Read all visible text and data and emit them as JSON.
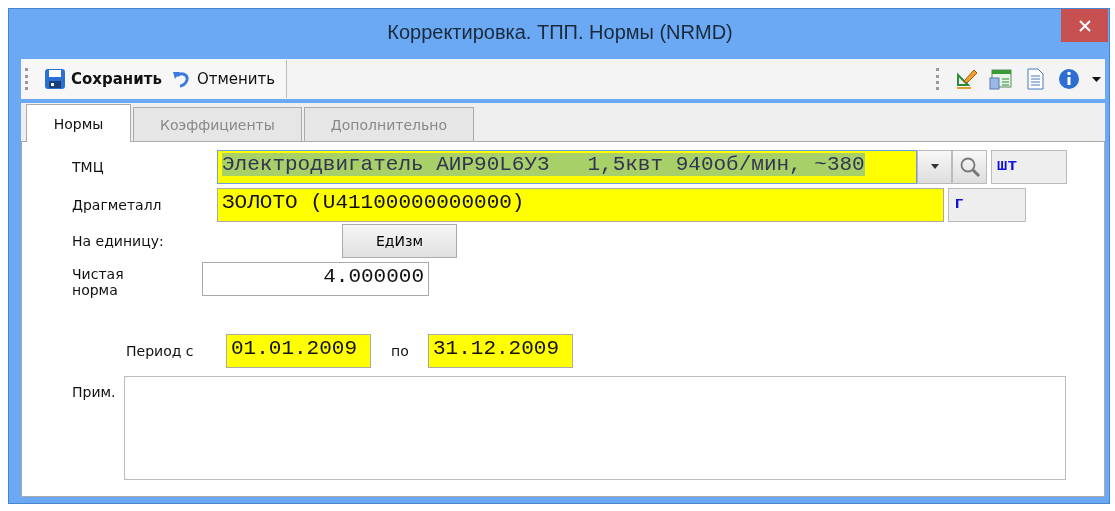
{
  "window": {
    "title": "Корректировка. ТПП. Нормы (NRMD)"
  },
  "toolbar": {
    "buttons": [
      {
        "label": "Сохранить",
        "kind": "save"
      },
      {
        "label": "Отменить",
        "kind": "undo"
      }
    ]
  },
  "tabs": [
    {
      "label": "Нормы",
      "selected": true
    },
    {
      "label": "Коэффициенты",
      "selected": false
    },
    {
      "label": "Дополнительно",
      "selected": false
    }
  ],
  "form": {
    "tmc": {
      "label": "ТМЦ",
      "value": "Электродвигатель АИР90L6У3   1,5квт 940об/мин, ~380",
      "text_selected": true,
      "unit": "шт"
    },
    "metal": {
      "label": "Драгметалл",
      "value": "ЗОЛОТО (U41100000000000)",
      "unit": "г"
    },
    "per_unit": {
      "label": "На единицу:",
      "button": "ЕдИзм"
    },
    "net_norm": {
      "label": "Чистая норма",
      "value": "4.000000"
    },
    "period": {
      "label": "Период с",
      "from": "01.01.2009",
      "to_label": "по",
      "to": "31.12.2009"
    },
    "note": {
      "label": "Прим."
    }
  }
}
